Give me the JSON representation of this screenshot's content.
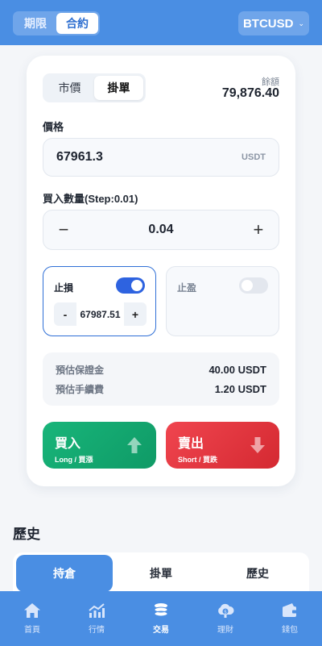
{
  "header": {
    "mode_tabs": [
      {
        "label": "期限",
        "active": false
      },
      {
        "label": "合約",
        "active": true
      }
    ],
    "symbol": "BTCUSD",
    "symbol_chevron": "⌄"
  },
  "order": {
    "tabs": [
      {
        "label": "市價",
        "active": false
      },
      {
        "label": "掛單",
        "active": true
      }
    ],
    "balance_label": "餘額",
    "balance_value": "79,876.40",
    "price_label": "價格",
    "price_value": "67961.3",
    "price_unit": "USDT",
    "qty_label": "買入數量(Step:0.01)",
    "qty_value": "0.04",
    "minus_symbol": "−",
    "plus_symbol": "+"
  },
  "stop_loss": {
    "label": "止損",
    "enabled": true,
    "value": "67987.51",
    "minus": "-",
    "plus": "+"
  },
  "take_profit": {
    "label": "止盈",
    "enabled": false
  },
  "estimate": {
    "margin_label": "預估保證金",
    "margin_value": "40.00 USDT",
    "fee_label": "預估手續費",
    "fee_value": "1.20 USDT"
  },
  "actions": {
    "buy_title": "買入",
    "buy_sub": "Long / 買漲",
    "buy_color": "#14a870",
    "sell_title": "賣出",
    "sell_sub": "Short / 買跌",
    "sell_color": "#e33a42"
  },
  "history": {
    "title": "歷史",
    "tabs": [
      {
        "label": "持倉",
        "active": true
      },
      {
        "label": "掛單",
        "active": false
      },
      {
        "label": "歷史",
        "active": false
      }
    ]
  },
  "nav": {
    "items": [
      {
        "label": "首頁",
        "icon": "home-icon"
      },
      {
        "label": "行情",
        "icon": "chart-icon"
      },
      {
        "label": "交易",
        "icon": "coins-icon",
        "active": true
      },
      {
        "label": "理財",
        "icon": "cloud-money-icon"
      },
      {
        "label": "錢包",
        "icon": "wallet-icon"
      }
    ]
  },
  "colors": {
    "primary": "#4a8ee3",
    "accent_blue": "#2e63e0",
    "buy": "#14a870",
    "sell": "#e33a42"
  }
}
